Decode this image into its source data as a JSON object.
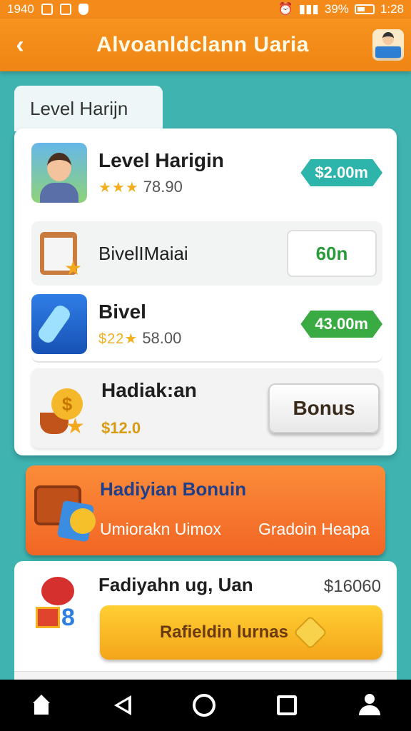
{
  "status_bar": {
    "time": "1940",
    "battery": "39%",
    "clock": "1:28"
  },
  "app_bar": {
    "back_icon": "chevron-left-icon",
    "title": "Alvoanldclann Uaria",
    "profile_icon": "user-card-icon"
  },
  "tab": {
    "label": "Level Harijn"
  },
  "items": [
    {
      "name": "Level Harigin",
      "stars": "★★★",
      "rating": "78.90",
      "price": "$2.00m"
    },
    {
      "name": "BivelIMaiai",
      "button": "60n"
    },
    {
      "name": "Bivel",
      "stars": "$22★",
      "rating": "58.00",
      "price": "43.00m"
    },
    {
      "name": "Hadiak:an",
      "price": "$12.0",
      "button": "Bonus"
    }
  ],
  "banner": {
    "title": "Hadiyian Bonuin",
    "left_text": "Umiorakn Uimox",
    "right_text": "Gradoin Heapa"
  },
  "reward": {
    "name": "Fadiyahn ug, Uan",
    "price": "$16060",
    "button": "Rafieldin lurnas"
  },
  "nav": [
    "home-icon",
    "back-icon",
    "home-circle-icon",
    "recents-icon",
    "profile-icon"
  ]
}
